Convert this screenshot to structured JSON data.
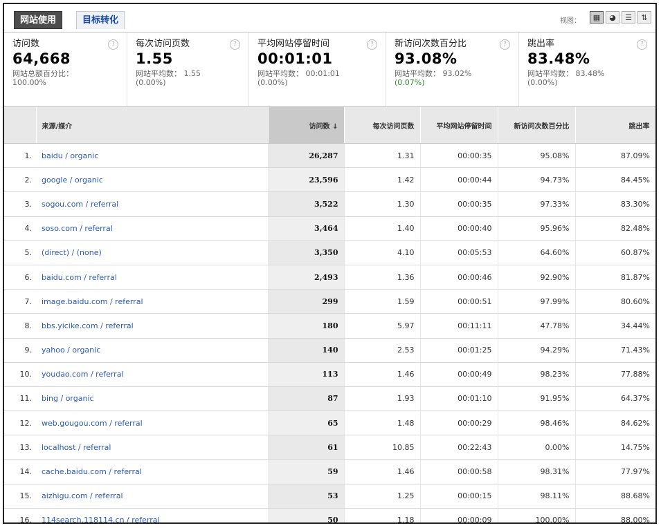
{
  "tabs": [
    {
      "label": "网站使用"
    },
    {
      "label": "目标转化"
    }
  ],
  "views": {
    "label": "视图：",
    "icons": [
      "table-view-icon",
      "pie-view-icon",
      "bar-view-icon",
      "compare-view-icon"
    ]
  },
  "metrics": [
    {
      "title": "访问数",
      "value": "64,668",
      "sub": "网站总额百分比：",
      "sub2": "100.00%",
      "sub2_green": false
    },
    {
      "title": "每次访问页数",
      "value": "1.55",
      "sub": "网站平均数： 1.55",
      "sub2": "(0.00%)",
      "sub2_green": false
    },
    {
      "title": "平均网站停留时间",
      "value": "00:01:01",
      "sub": "网站平均数： 00:01:01",
      "sub2": "(0.00%)",
      "sub2_green": false
    },
    {
      "title": "新访问次数百分比",
      "value": "93.08%",
      "sub": "网站平均数： 93.02%",
      "sub2": "(0.07%)",
      "sub2_green": true
    },
    {
      "title": "跳出率",
      "value": "83.48%",
      "sub": "网站平均数： 83.48%",
      "sub2": "(0.00%)",
      "sub2_green": false
    }
  ],
  "table": {
    "headers": {
      "source": "来源/媒介",
      "visits": "访问数 ↓",
      "pages": "每次访问页数",
      "time": "平均网站停留时间",
      "new": "新访问次数百分比",
      "bounce": "跳出率"
    },
    "rows": [
      {
        "idx": "1.",
        "source": "baidu / organic",
        "visits": "26,287",
        "pages": "1.31",
        "time": "00:00:35",
        "new": "95.08%",
        "bounce": "87.09%"
      },
      {
        "idx": "2.",
        "source": "google / organic",
        "visits": "23,596",
        "pages": "1.42",
        "time": "00:00:44",
        "new": "94.73%",
        "bounce": "84.45%"
      },
      {
        "idx": "3.",
        "source": "sogou.com / referral",
        "visits": "3,522",
        "pages": "1.30",
        "time": "00:00:35",
        "new": "97.33%",
        "bounce": "83.30%"
      },
      {
        "idx": "4.",
        "source": "soso.com / referral",
        "visits": "3,464",
        "pages": "1.40",
        "time": "00:00:40",
        "new": "95.96%",
        "bounce": "82.48%"
      },
      {
        "idx": "5.",
        "source": "(direct) / (none)",
        "visits": "3,350",
        "pages": "4.10",
        "time": "00:05:53",
        "new": "64.60%",
        "bounce": "60.87%"
      },
      {
        "idx": "6.",
        "source": "baidu.com / referral",
        "visits": "2,493",
        "pages": "1.36",
        "time": "00:00:46",
        "new": "92.90%",
        "bounce": "81.87%"
      },
      {
        "idx": "7.",
        "source": "image.baidu.com / referral",
        "visits": "299",
        "pages": "1.59",
        "time": "00:00:51",
        "new": "97.99%",
        "bounce": "80.60%"
      },
      {
        "idx": "8.",
        "source": "bbs.yicike.com / referral",
        "visits": "180",
        "pages": "5.97",
        "time": "00:11:11",
        "new": "47.78%",
        "bounce": "34.44%"
      },
      {
        "idx": "9.",
        "source": "yahoo / organic",
        "visits": "140",
        "pages": "2.53",
        "time": "00:01:25",
        "new": "94.29%",
        "bounce": "71.43%"
      },
      {
        "idx": "10.",
        "source": "youdao.com / referral",
        "visits": "113",
        "pages": "1.46",
        "time": "00:00:49",
        "new": "98.23%",
        "bounce": "77.88%"
      },
      {
        "idx": "11.",
        "source": "bing / organic",
        "visits": "87",
        "pages": "1.93",
        "time": "00:01:10",
        "new": "91.95%",
        "bounce": "64.37%"
      },
      {
        "idx": "12.",
        "source": "web.gougou.com / referral",
        "visits": "65",
        "pages": "1.48",
        "time": "00:00:29",
        "new": "98.46%",
        "bounce": "84.62%"
      },
      {
        "idx": "13.",
        "source": "localhost / referral",
        "visits": "61",
        "pages": "10.85",
        "time": "00:22:43",
        "new": "0.00%",
        "bounce": "14.75%"
      },
      {
        "idx": "14.",
        "source": "cache.baidu.com / referral",
        "visits": "59",
        "pages": "1.46",
        "time": "00:00:58",
        "new": "98.31%",
        "bounce": "77.97%"
      },
      {
        "idx": "15.",
        "source": "aizhigu.com / referral",
        "visits": "53",
        "pages": "1.25",
        "time": "00:00:15",
        "new": "98.11%",
        "bounce": "88.68%"
      },
      {
        "idx": "16.",
        "source": "114search.118114.cn / referral",
        "visits": "50",
        "pages": "1.18",
        "time": "00:00:09",
        "new": "100.00%",
        "bounce": "88.00%"
      }
    ]
  }
}
